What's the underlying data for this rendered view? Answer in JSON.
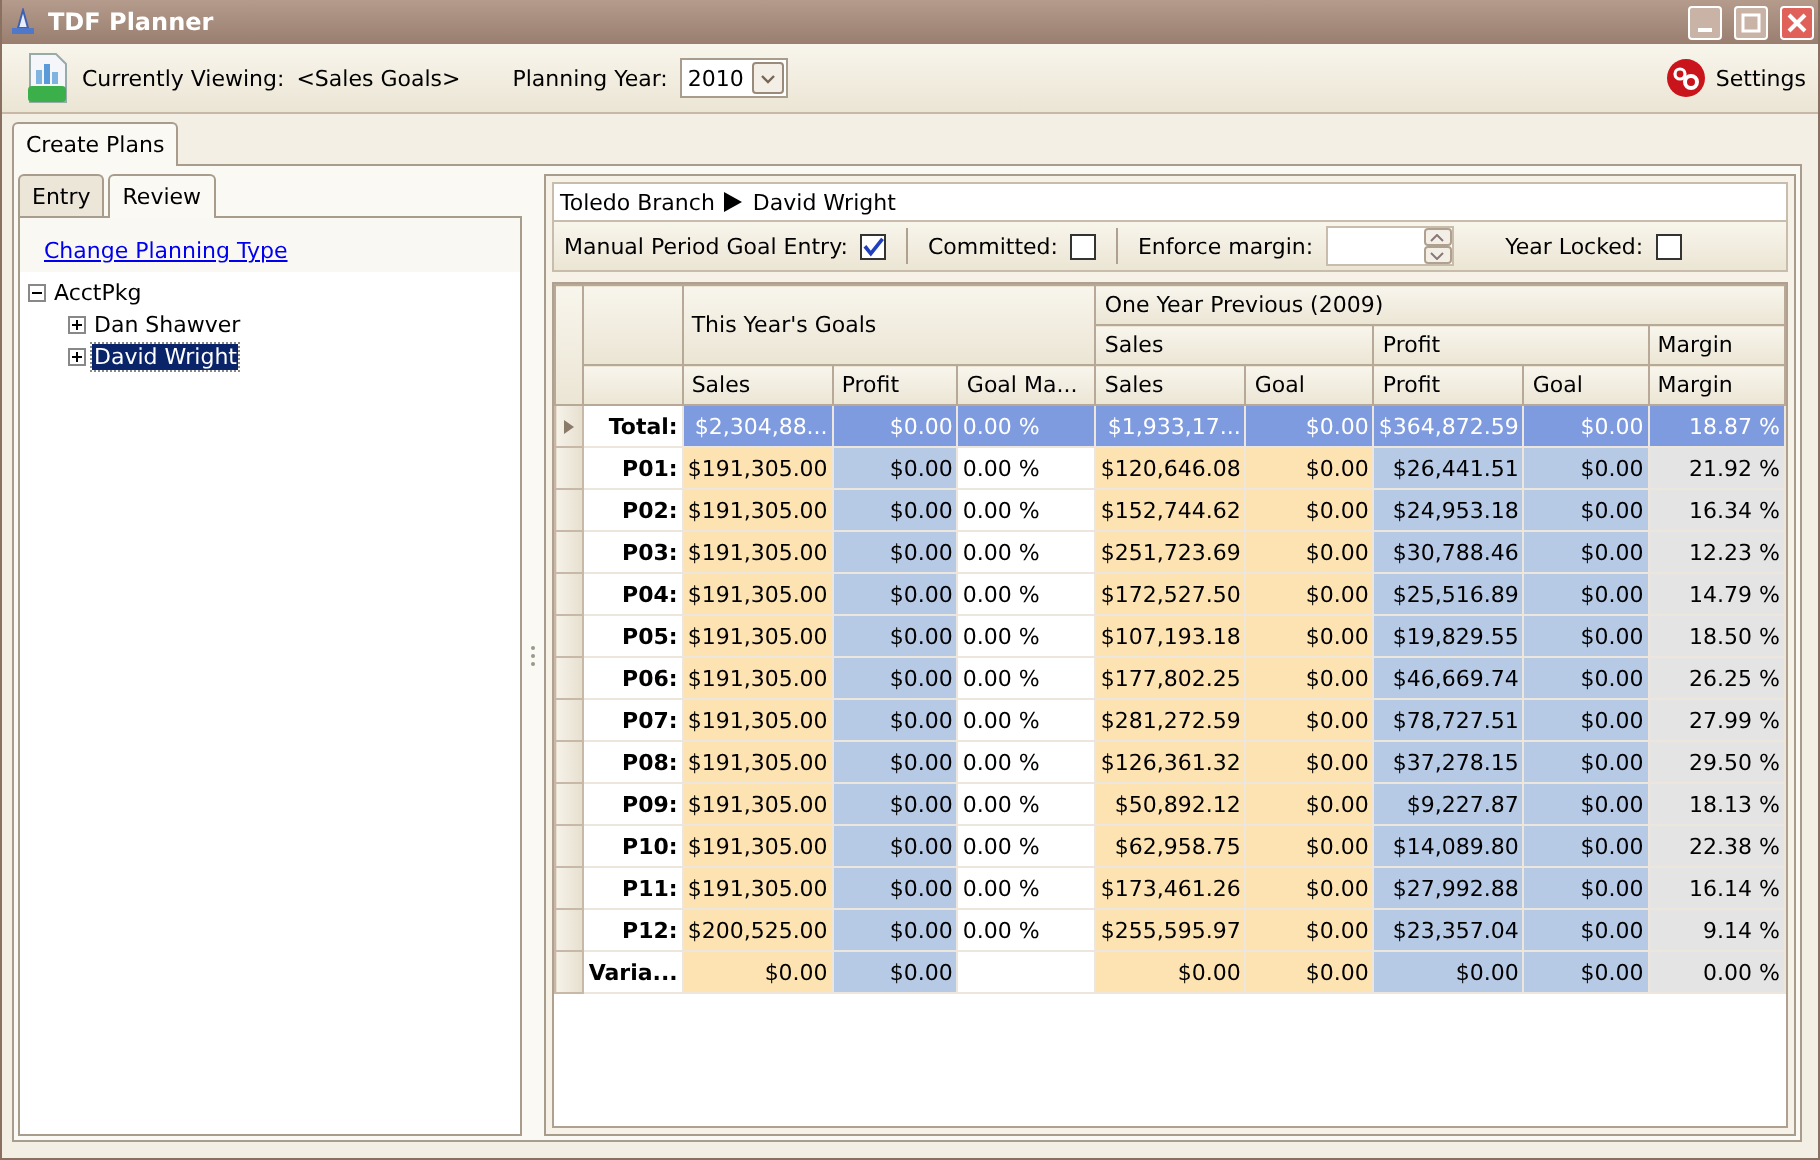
{
  "window": {
    "title": "TDF Planner"
  },
  "toolbar": {
    "viewing_label": "Currently Viewing:",
    "viewing_value": "<Sales Goals>",
    "year_label": "Planning Year:",
    "year_value": "2010",
    "settings": "Settings"
  },
  "main_tabs": [
    {
      "label": "Create Plans",
      "selected": true
    }
  ],
  "side_tabs": [
    {
      "label": "Entry",
      "selected": false
    },
    {
      "label": "Review",
      "selected": true
    }
  ],
  "change_link": "Change Planning Type",
  "tree": [
    {
      "label": "AcctPkg",
      "expanded": true,
      "selected": false,
      "children": [
        {
          "label": "Dan Shawver",
          "expanded": false,
          "selected": false
        },
        {
          "label": "David Wright",
          "expanded": false,
          "selected": true
        }
      ]
    }
  ],
  "breadcrumb": [
    "Toledo Branch",
    "David Wright"
  ],
  "options": {
    "manual_label": "Manual Period Goal Entry:",
    "manual_checked": true,
    "committed_label": "Committed:",
    "committed_checked": false,
    "margin_label": "Enforce margin:",
    "locked_label": "Year Locked:",
    "locked_checked": false
  },
  "table": {
    "groups": [
      {
        "label": "This Year's Goals",
        "columns": [
          {
            "label": "Sales",
            "kind": "sales"
          },
          {
            "label": "Profit",
            "kind": "profit"
          },
          {
            "label": "Goal Ma...",
            "kind": "plain"
          }
        ]
      },
      {
        "label": "One Year Previous (2009)",
        "subgroups": [
          {
            "label": "Sales",
            "columns": [
              {
                "label": "Sales",
                "kind": "sales"
              },
              {
                "label": "Goal",
                "kind": "sales"
              }
            ]
          },
          {
            "label": "Profit",
            "columns": [
              {
                "label": "Profit",
                "kind": "profit"
              },
              {
                "label": "Goal",
                "kind": "profit"
              }
            ]
          },
          {
            "label": "Margin",
            "columns": [
              {
                "label": "Margin",
                "kind": "margin"
              }
            ]
          }
        ]
      }
    ],
    "rows": [
      {
        "label": "Total:",
        "selected": true,
        "cells": [
          "$2,304,88...",
          "$0.00",
          "0.00 %",
          "$1,933,17...",
          "$0.00",
          "$364,872.59",
          "$0.00",
          "18.87 %"
        ]
      },
      {
        "label": "P01:",
        "selected": false,
        "cells": [
          "$191,305.00",
          "$0.00",
          "0.00 %",
          "$120,646.08",
          "$0.00",
          "$26,441.51",
          "$0.00",
          "21.92 %"
        ]
      },
      {
        "label": "P02:",
        "selected": false,
        "cells": [
          "$191,305.00",
          "$0.00",
          "0.00 %",
          "$152,744.62",
          "$0.00",
          "$24,953.18",
          "$0.00",
          "16.34 %"
        ]
      },
      {
        "label": "P03:",
        "selected": false,
        "cells": [
          "$191,305.00",
          "$0.00",
          "0.00 %",
          "$251,723.69",
          "$0.00",
          "$30,788.46",
          "$0.00",
          "12.23 %"
        ]
      },
      {
        "label": "P04:",
        "selected": false,
        "cells": [
          "$191,305.00",
          "$0.00",
          "0.00 %",
          "$172,527.50",
          "$0.00",
          "$25,516.89",
          "$0.00",
          "14.79 %"
        ]
      },
      {
        "label": "P05:",
        "selected": false,
        "cells": [
          "$191,305.00",
          "$0.00",
          "0.00 %",
          "$107,193.18",
          "$0.00",
          "$19,829.55",
          "$0.00",
          "18.50 %"
        ]
      },
      {
        "label": "P06:",
        "selected": false,
        "cells": [
          "$191,305.00",
          "$0.00",
          "0.00 %",
          "$177,802.25",
          "$0.00",
          "$46,669.74",
          "$0.00",
          "26.25 %"
        ]
      },
      {
        "label": "P07:",
        "selected": false,
        "cells": [
          "$191,305.00",
          "$0.00",
          "0.00 %",
          "$281,272.59",
          "$0.00",
          "$78,727.51",
          "$0.00",
          "27.99 %"
        ]
      },
      {
        "label": "P08:",
        "selected": false,
        "cells": [
          "$191,305.00",
          "$0.00",
          "0.00 %",
          "$126,361.32",
          "$0.00",
          "$37,278.15",
          "$0.00",
          "29.50 %"
        ]
      },
      {
        "label": "P09:",
        "selected": false,
        "cells": [
          "$191,305.00",
          "$0.00",
          "0.00 %",
          "$50,892.12",
          "$0.00",
          "$9,227.87",
          "$0.00",
          "18.13 %"
        ]
      },
      {
        "label": "P10:",
        "selected": false,
        "cells": [
          "$191,305.00",
          "$0.00",
          "0.00 %",
          "$62,958.75",
          "$0.00",
          "$14,089.80",
          "$0.00",
          "22.38 %"
        ]
      },
      {
        "label": "P11:",
        "selected": false,
        "cells": [
          "$191,305.00",
          "$0.00",
          "0.00 %",
          "$173,461.26",
          "$0.00",
          "$27,992.88",
          "$0.00",
          "16.14 %"
        ]
      },
      {
        "label": "P12:",
        "selected": false,
        "cells": [
          "$200,525.00",
          "$0.00",
          "0.00 %",
          "$255,595.97",
          "$0.00",
          "$23,357.04",
          "$0.00",
          "9.14 %"
        ]
      },
      {
        "label": "Varia...",
        "selected": false,
        "cells": [
          "$0.00",
          "$0.00",
          null,
          "$0.00",
          "$0.00",
          "$0.00",
          "$0.00",
          "0.00 %"
        ]
      }
    ]
  }
}
